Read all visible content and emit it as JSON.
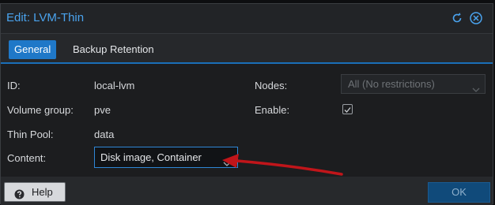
{
  "window": {
    "title": "Edit: LVM-Thin"
  },
  "tabs": [
    {
      "label": "General",
      "active": true
    },
    {
      "label": "Backup Retention",
      "active": false
    }
  ],
  "form": {
    "id_label": "ID:",
    "id_value": "local-lvm",
    "volume_group_label": "Volume group:",
    "volume_group_value": "pve",
    "thin_pool_label": "Thin Pool:",
    "thin_pool_value": "data",
    "content_label": "Content:",
    "content_value": "Disk image, Container",
    "nodes_label": "Nodes:",
    "nodes_value": "All (No restrictions)",
    "enable_label": "Enable:",
    "enable_checked": true
  },
  "footer": {
    "help_label": "Help",
    "ok_label": "OK"
  },
  "icons": [
    "reset-icon",
    "close-icon",
    "chevron-down-icon",
    "checkmark-icon",
    "help-icon"
  ],
  "colors": {
    "accent": "#1f78c8",
    "title": "#4aa3ee",
    "annotation_arrow": "#c0151a"
  }
}
